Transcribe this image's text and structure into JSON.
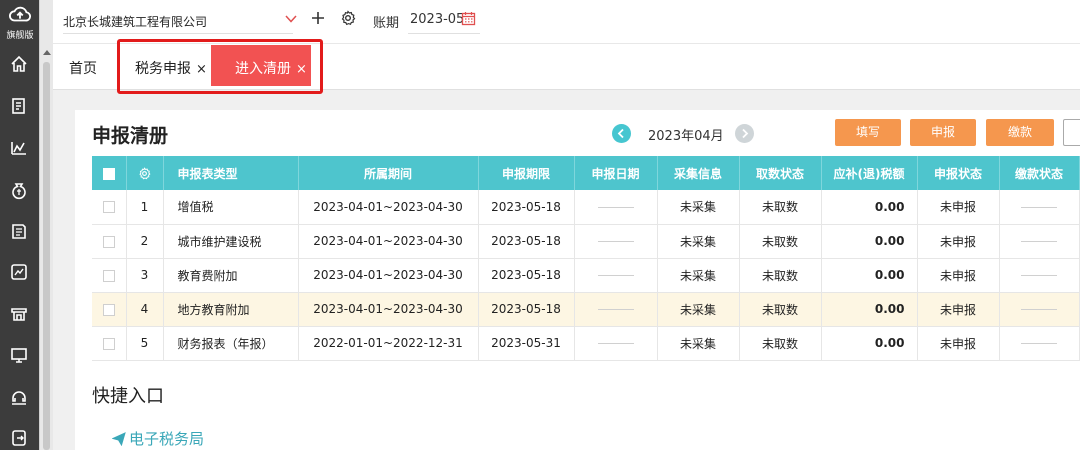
{
  "sidebar": {
    "logo_label": "旗舰版",
    "icons": [
      "home-icon",
      "document-icon",
      "chart-icon",
      "money-bag-icon",
      "ledger-icon",
      "report-icon",
      "shop-icon",
      "monitor-icon",
      "service-icon",
      "exit-icon"
    ]
  },
  "topbar": {
    "company": "北京长城建筑工程有限公司",
    "period_label": "账期",
    "period_value": "2023-05"
  },
  "tabs": {
    "home": "首页",
    "tax": "税务申报",
    "active": "进入清册",
    "close_symbol": "×"
  },
  "page": {
    "title": "申报清册",
    "month": "2023年04月",
    "buttons": {
      "fill": "填写",
      "declare": "申报",
      "pay": "缴款",
      "more": ""
    }
  },
  "table": {
    "headers": [
      "",
      "",
      "申报表类型",
      "所属期间",
      "申报期限",
      "申报日期",
      "采集信息",
      "取数状态",
      "应补(退)税额",
      "申报状态",
      "缴款状态"
    ],
    "rows": [
      {
        "no": "1",
        "type": "增值税",
        "period": "2023-04-01~2023-04-30",
        "deadline": "2023-05-18",
        "collect": "未采集",
        "fetch": "未取数",
        "amount": "0.00",
        "status": "未申报"
      },
      {
        "no": "2",
        "type": "城市维护建设税",
        "period": "2023-04-01~2023-04-30",
        "deadline": "2023-05-18",
        "collect": "未采集",
        "fetch": "未取数",
        "amount": "0.00",
        "status": "未申报"
      },
      {
        "no": "3",
        "type": "教育费附加",
        "period": "2023-04-01~2023-04-30",
        "deadline": "2023-05-18",
        "collect": "未采集",
        "fetch": "未取数",
        "amount": "0.00",
        "status": "未申报"
      },
      {
        "no": "4",
        "type": "地方教育附加",
        "period": "2023-04-01~2023-04-30",
        "deadline": "2023-05-18",
        "collect": "未采集",
        "fetch": "未取数",
        "amount": "0.00",
        "status": "未申报"
      },
      {
        "no": "5",
        "type": "财务报表（年报）",
        "period": "2022-01-01~2022-12-31",
        "deadline": "2023-05-31",
        "collect": "未采集",
        "fetch": "未取数",
        "amount": "0.00",
        "status": "未申报"
      }
    ]
  },
  "quick": {
    "title": "快捷入口",
    "link": "电子税务局"
  },
  "colors": {
    "sidebar": "#3c3c3c",
    "header_teal": "#4ec5cd",
    "action_orange": "#f5974e",
    "active_tab": "#f25252",
    "highlight_red": "#e21b1b",
    "row_highlight": "#fdf6e3",
    "link": "#3aa7b8"
  }
}
